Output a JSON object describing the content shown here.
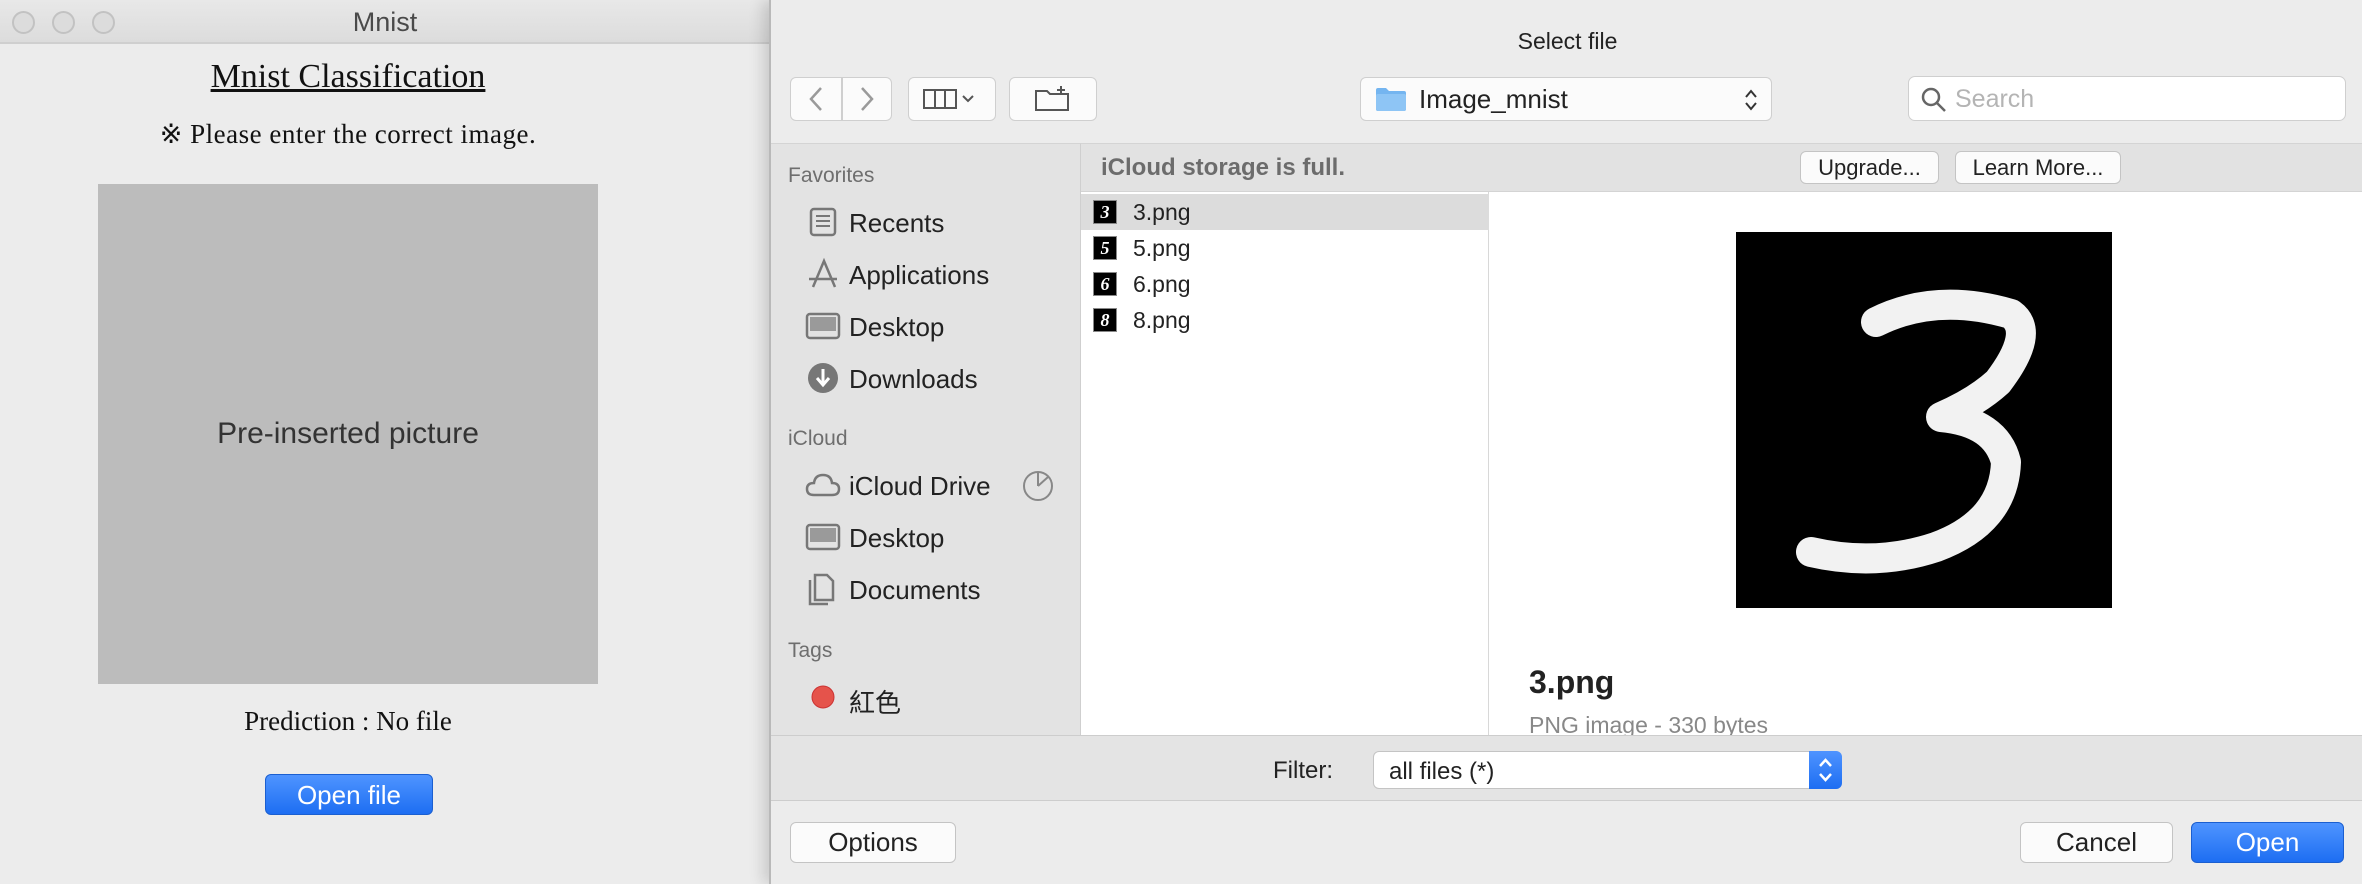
{
  "mnist_window": {
    "title": "Mnist",
    "heading": "Mnist Classification",
    "note": "※ Please enter the correct image.",
    "placeholder_image_text": "Pre-inserted picture",
    "prediction": "Prediction : No file",
    "open_file_label": "Open file"
  },
  "dialog": {
    "title": "Select file",
    "location": "Image_mnist",
    "search_placeholder": "Search",
    "sidebar": {
      "favorites_label": "Favorites",
      "favorites": [
        {
          "label": "Recents",
          "icon": "recents-icon"
        },
        {
          "label": "Applications",
          "icon": "applications-icon"
        },
        {
          "label": "Desktop",
          "icon": "desktop-icon"
        },
        {
          "label": "Downloads",
          "icon": "downloads-icon"
        }
      ],
      "icloud_label": "iCloud",
      "icloud": [
        {
          "label": "iCloud Drive",
          "icon": "icloud-icon"
        },
        {
          "label": "Desktop",
          "icon": "desktop-icon"
        },
        {
          "label": "Documents",
          "icon": "documents-icon"
        }
      ],
      "tags_label": "Tags",
      "tags": [
        {
          "label": "紅色",
          "color": "#e5534b"
        }
      ]
    },
    "icloud_banner": {
      "message": "iCloud storage is full.",
      "upgrade_label": "Upgrade...",
      "learn_more_label": "Learn More..."
    },
    "files": [
      {
        "name": "3.png",
        "digit": "3",
        "selected": true
      },
      {
        "name": "5.png",
        "digit": "5",
        "selected": false
      },
      {
        "name": "6.png",
        "digit": "6",
        "selected": false
      },
      {
        "name": "8.png",
        "digit": "8",
        "selected": false
      }
    ],
    "preview": {
      "name": "3.png",
      "meta": "PNG image - 330 bytes",
      "digit": "3"
    },
    "filter_label": "Filter:",
    "filter_value": "all files (*)",
    "options_label": "Options",
    "cancel_label": "Cancel",
    "open_label": "Open"
  },
  "colors": {
    "accent": "#1d6ef2",
    "window_bg": "#ececec",
    "sidebar_bg": "#e3e3e3"
  }
}
